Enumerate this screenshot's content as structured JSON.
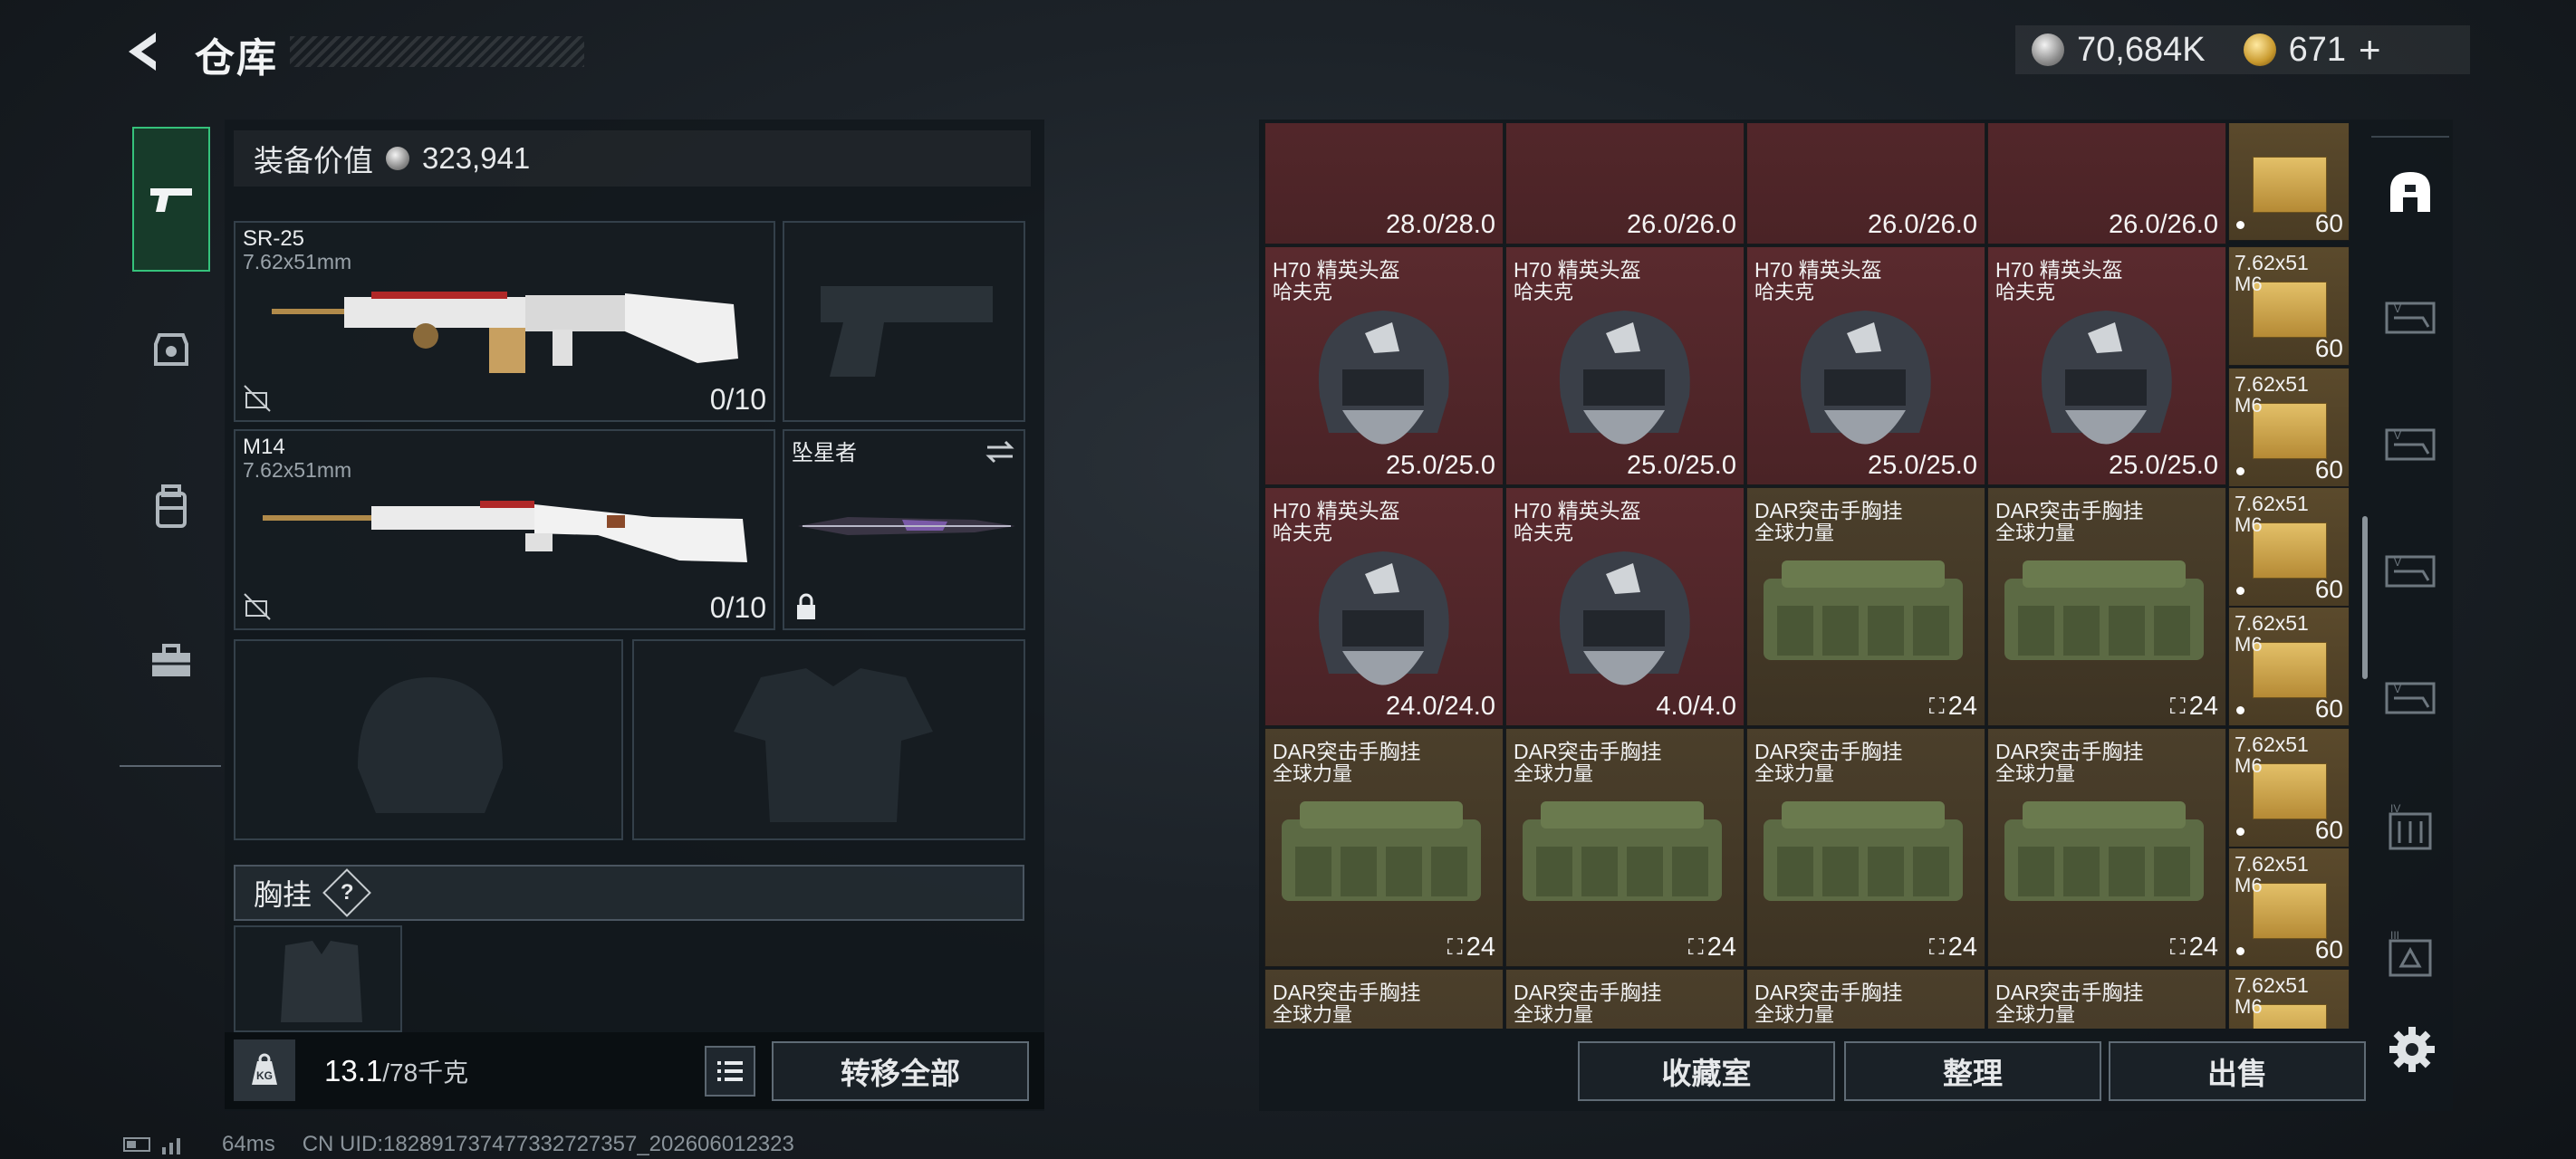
{
  "header": {
    "title": "仓库"
  },
  "currency": {
    "silver": "70,684K",
    "gold": "671",
    "gold_add": "+"
  },
  "loadout": {
    "value_label": "装备价值",
    "value": "323,941",
    "weapons": [
      {
        "name": "SR-25",
        "caliber": "7.62x51mm",
        "ammo": "0/10"
      },
      {
        "name": "M14",
        "caliber": "7.62x51mm",
        "ammo": "0/10"
      }
    ],
    "melee": {
      "name": "坠星者"
    },
    "rig_label": "胸挂",
    "rig_help": "?",
    "weight": "13.1",
    "weight_max": "/78千克",
    "transfer_all": "转移全部"
  },
  "status": {
    "ping": "64ms",
    "uid": "CN UID:1828917374773327273​57_202606012323"
  },
  "inventory": {
    "top_row": [
      "28.0/28.0",
      "26.0/26.0",
      "26.0/26.0",
      "26.0/26.0"
    ],
    "row1": [
      {
        "name": "H70 精英头盔",
        "brand": "哈夫克",
        "dur": "25.0/25.0"
      },
      {
        "name": "H70 精英头盔",
        "brand": "哈夫克",
        "dur": "25.0/25.0"
      },
      {
        "name": "H70 精英头盔",
        "brand": "哈夫克",
        "dur": "25.0/25.0"
      },
      {
        "name": "H70 精英头盔",
        "brand": "哈夫克",
        "dur": "25.0/25.0"
      }
    ],
    "row2": [
      {
        "name": "H70 精英头盔",
        "brand": "哈夫克",
        "dur": "24.0/24.0"
      },
      {
        "name": "H70 精英头盔",
        "brand": "哈夫克",
        "dur": "4.0/4.0"
      },
      {
        "name": "DAR突击手胸挂",
        "brand": "全球力量",
        "count": "24"
      },
      {
        "name": "DAR突击手胸挂",
        "brand": "全球力量",
        "count": "24"
      }
    ],
    "row3": [
      {
        "name": "DAR突击手胸挂",
        "brand": "全球力量",
        "count": "24"
      },
      {
        "name": "DAR突击手胸挂",
        "brand": "全球力量",
        "count": "24"
      },
      {
        "name": "DAR突击手胸挂",
        "brand": "全球力量",
        "count": "24"
      },
      {
        "name": "DAR突击手胸挂",
        "brand": "全球力量",
        "count": "24"
      }
    ],
    "row4": [
      {
        "name": "DAR突击手胸挂",
        "brand": "全球力量"
      },
      {
        "name": "DAR突击手胸挂",
        "brand": "全球力量"
      },
      {
        "name": "DAR突击手胸挂",
        "brand": "全球力量"
      },
      {
        "name": "DAR突击手胸挂",
        "brand": "全球力量"
      }
    ],
    "ammo_name": "7.62x51",
    "ammo_sub": "M6",
    "ammo_qty": "60"
  },
  "actions": {
    "collection": "收藏室",
    "organize": "整理",
    "sell": "出售"
  }
}
